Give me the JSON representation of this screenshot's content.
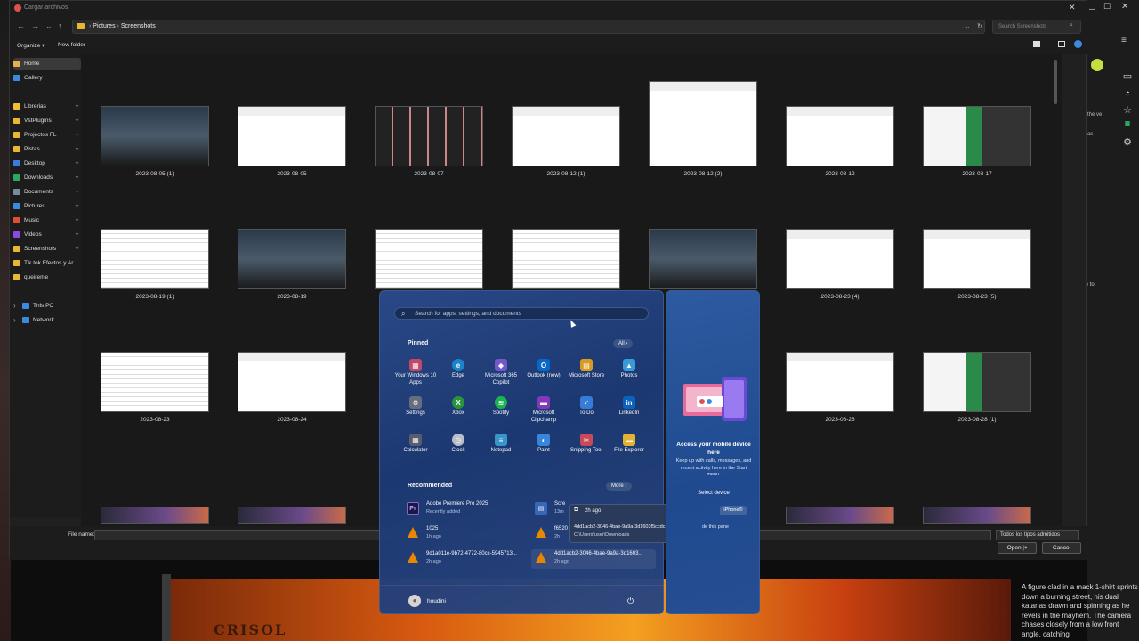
{
  "dialog": {
    "title": "Cargar archivos",
    "breadcrumb": [
      "Pictures",
      "Screenshots"
    ],
    "search_placeholder": "Search Screenshots",
    "organize": "Organize",
    "new_folder": "New folder",
    "file_name_label": "File name:",
    "file_type": "Todos los tipos admitidos",
    "open": "Open",
    "cancel": "Cancel"
  },
  "nav": [
    {
      "label": "Home",
      "icon": "home-icon",
      "color": "#e8b04a"
    },
    {
      "label": "Gallery",
      "icon": "gallery-icon",
      "color": "#3a8be0"
    },
    {
      "label": "Librerias",
      "icon": "star-icon",
      "color": "#f0c030"
    },
    {
      "label": "VstPlugins",
      "icon": "folder-icon",
      "color": "#e8b830"
    },
    {
      "label": "Projectos FL",
      "icon": "folder-icon",
      "color": "#e8b830"
    },
    {
      "label": "Pistas",
      "icon": "folder-icon",
      "color": "#e8b830"
    },
    {
      "label": "Desktop",
      "icon": "desktop-icon",
      "color": "#3a7be0"
    },
    {
      "label": "Downloads",
      "icon": "download-icon",
      "color": "#2aa860"
    },
    {
      "label": "Documents",
      "icon": "documents-icon",
      "color": "#7a8a9a"
    },
    {
      "label": "Pictures",
      "icon": "pictures-icon",
      "color": "#3a8be0"
    },
    {
      "label": "Music",
      "icon": "music-icon",
      "color": "#e05030"
    },
    {
      "label": "Videos",
      "icon": "videos-icon",
      "color": "#8a4ae0"
    },
    {
      "label": "Screenshots",
      "icon": "folder-icon",
      "color": "#e8b830"
    },
    {
      "label": "Tik tok Efectos y Ar",
      "icon": "folder-icon",
      "color": "#e8b830"
    },
    {
      "label": "queireme",
      "icon": "folder-icon",
      "color": "#e8b830"
    },
    {
      "label": "This PC",
      "icon": "pc-icon",
      "color": "#3a8be0"
    },
    {
      "label": "Network",
      "icon": "network-icon",
      "color": "#3a8be0"
    }
  ],
  "thumbs": [
    "2023-08-05 (1)",
    "2023-08-05",
    "2023-08-07",
    "2023-08-12 (1)",
    "2023-08-12 (2)",
    "2023-08-12",
    "2023-08-17",
    "2023-08-19 (1)",
    "2023-08-19",
    "",
    "",
    "",
    "2023-08-23 (4)",
    "2023-08-23 (5)",
    "2023-08-23",
    "2023-08-24",
    "",
    "",
    "",
    "2023-08-26",
    "2023-08-28 (1)"
  ],
  "start": {
    "search_placeholder": "Search for apps, settings, and documents",
    "pinned_label": "Pinned",
    "all_label": "All",
    "recommended_label": "Recommended",
    "more_label": "More",
    "apps": [
      {
        "label": "Your Windows 10 Apps",
        "icon": "apps-icon",
        "color": "#c84a6a",
        "glyph": "▦"
      },
      {
        "label": "Edge",
        "icon": "edge-icon",
        "color": "#1a8ad0",
        "glyph": "e"
      },
      {
        "label": "Microsoft 365 Copilot",
        "icon": "copilot-icon",
        "color": "#7a5ad0",
        "glyph": "◆"
      },
      {
        "label": "Outlook (new)",
        "icon": "outlook-icon",
        "color": "#0a6ad0",
        "glyph": "O"
      },
      {
        "label": "Microsoft Store",
        "icon": "store-icon",
        "color": "#e0a020",
        "glyph": "▤"
      },
      {
        "label": "Photos",
        "icon": "photos-icon",
        "color": "#3aa0e0",
        "glyph": "▲"
      },
      {
        "label": "Settings",
        "icon": "settings-icon",
        "color": "#6a7080",
        "glyph": "⚙"
      },
      {
        "label": "Xbox",
        "icon": "xbox-icon",
        "color": "#2a9a3a",
        "glyph": "X"
      },
      {
        "label": "Spotify",
        "icon": "spotify-icon",
        "color": "#1db954",
        "glyph": "≋"
      },
      {
        "label": "Microsoft Clipchamp",
        "icon": "clipchamp-icon",
        "color": "#8a3ac0",
        "glyph": "▬"
      },
      {
        "label": "To Do",
        "icon": "todo-icon",
        "color": "#3a80e0",
        "glyph": "✓"
      },
      {
        "label": "LinkedIn",
        "icon": "linkedin-icon",
        "color": "#0a66c2",
        "glyph": "in"
      },
      {
        "label": "Calculator",
        "icon": "calculator-icon",
        "color": "#5a6070",
        "glyph": "▦"
      },
      {
        "label": "Clock",
        "icon": "clock-icon",
        "color": "#c0c4cc",
        "glyph": "◷"
      },
      {
        "label": "Notepad",
        "icon": "notepad-icon",
        "color": "#3a9ad0",
        "glyph": "≡"
      },
      {
        "label": "Paint",
        "icon": "paint-icon",
        "color": "#3a8ae0",
        "glyph": "◐"
      },
      {
        "label": "Snipping Tool",
        "icon": "snipping-icon",
        "color": "#d04a5a",
        "glyph": "✂"
      },
      {
        "label": "File Explorer",
        "icon": "folder-icon",
        "color": "#e8b830",
        "glyph": "▬"
      }
    ],
    "recommended": [
      {
        "title": "Adobe Premiere Pro 2025",
        "sub": "Recently added",
        "icon": "premiere-icon",
        "glyph": "Pr",
        "color": "#1a1a4a"
      },
      {
        "title": "Scre",
        "sub": "13m",
        "icon": "document-icon",
        "glyph": "▤",
        "color": "#3a6ac0"
      },
      {
        "title": "1025",
        "sub": "1h ago",
        "icon": "vlc-icon",
        "glyph": "",
        "color": ""
      },
      {
        "title": "f6520",
        "sub": "2h",
        "icon": "vlc-icon",
        "glyph": "",
        "color": ""
      },
      {
        "title": "9d1a011e-9b72-4772-80cc-5945713...",
        "sub": "2h ago",
        "icon": "vlc-icon",
        "glyph": "",
        "color": ""
      },
      {
        "title": "4dd1acb2-3046-4bae-9a9a-3d1603...",
        "sub": "2h ago",
        "icon": "vlc-icon",
        "glyph": "",
        "color": ""
      }
    ],
    "tooltip_time": "2h ago",
    "tooltip_name": "4dd1acb2-3046-4bae-9a9a-3d1603f5ccdc",
    "tooltip_path": "C:\\Users\\user\\Downloads",
    "user": "houdini .",
    "phone_title": "Access your mobile device here",
    "phone_desc": "Keep up with calls, messages, and recent activity here in the Start menu.",
    "phone_select": "Select device",
    "phone_iphone": "iPhone®",
    "phone_hide": "de this pane"
  },
  "browser": {
    "preview_text": "Select a file to preview.",
    "side_text": "the ve as",
    "description": "A figure clad in a mack 1-shirt sprints down a burning street, his dual katanas drawn and spinning as he revels in the mayhem. The camera chases closely from a low front angle, catching",
    "banner_text": "CRISOL"
  }
}
